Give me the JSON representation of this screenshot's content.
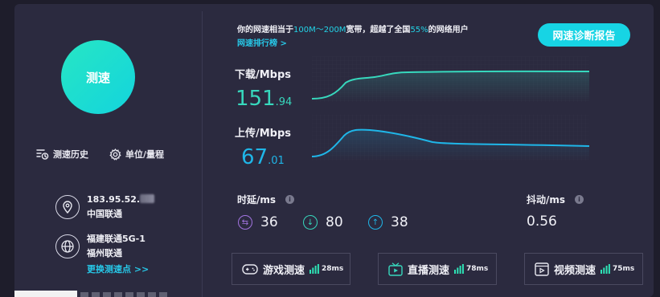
{
  "left": {
    "speed_button": "测速",
    "history_label": "测速历史",
    "unit_label": "单位/量程",
    "ip": "183.95.52.",
    "isp": "中国联通",
    "node_name": "福建联通5G-1",
    "node_city": "福州联通",
    "change_node": "更换测速点 >>"
  },
  "summary": {
    "prefix": "你的网速相当于",
    "bandwidth": "100M～200M",
    "middle": "宽带，超越了全国",
    "percent": "55%",
    "suffix": "的网络用户",
    "ranking_link": "网速排行榜 >",
    "report_button": "网速诊断报告"
  },
  "download": {
    "label": "下载/Mbps",
    "int": "151",
    "dec": ".94",
    "color": "#37d8bd"
  },
  "upload": {
    "label": "上传/Mbps",
    "int": "67",
    "dec": ".01",
    "color": "#1fb6e8"
  },
  "latency": {
    "label": "时延/ms",
    "values": [
      "36",
      "80",
      "38"
    ]
  },
  "jitter": {
    "label": "抖动/ms",
    "value": "0.56"
  },
  "tests": [
    {
      "label": "游戏测速",
      "ms": "28ms"
    },
    {
      "label": "直播测速",
      "ms": "78ms"
    },
    {
      "label": "视频测速",
      "ms": "75ms"
    }
  ]
}
